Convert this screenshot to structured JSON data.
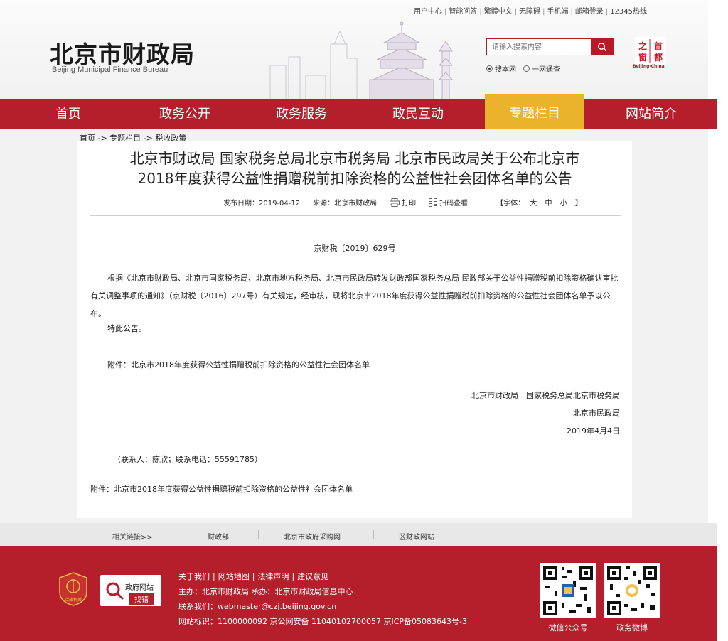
{
  "header": {
    "util_links": [
      "用户中心",
      "智能问答",
      "繁體中文",
      "无障碍",
      "手机端",
      "邮箱登录",
      "12345热线"
    ],
    "logo_cn": "北京市财政局",
    "logo_en": "Beijing Municipal Finance Bureau",
    "search": {
      "placeholder": "请输入搜索内容"
    },
    "radio_site": "搜本网",
    "radio_all": "一网通查",
    "seal_text": [
      "首",
      "都",
      "之",
      "窗"
    ],
    "seal_caption": "Beijing·China"
  },
  "nav": {
    "items": [
      "首页",
      "政务公开",
      "政务服务",
      "政民互动",
      "专题栏目",
      "网站简介"
    ],
    "active_index": 4
  },
  "breadcrumb": "首页 -> 专题栏目 -> 税收政策",
  "article": {
    "title_line1": "北京市财政局 国家税务总局北京市税务局 北京市民政局关于公布北京市",
    "title_line2": "2018年度获得公益性捐赠税前扣除资格的公益性社会团体名单的公告",
    "publish_date": "发布日期：2019-04-12",
    "source": "来源：北京市财政局",
    "print_label": "打印",
    "qr_label": "扫码查看",
    "font_label": "【字体：",
    "font_large": "大",
    "font_medium": "中",
    "font_small": "小",
    "font_end": "】",
    "doc_number": "京财税〔2019〕629号",
    "paragraph1": "根据《北京市财政局、北京市国家税务局、北京市地方税务局、北京市民政局转发财政部国家税务总局 民政部关于公益性捐赠税前扣除资格确认审批有关调整事项的通知》（京财税〔2016〕297号）有关规定，经审核，现将北京市2018年度获得公益性捐赠税前扣除资格的公益性社会团体名单予以公布。",
    "paragraph2": "特此公告。",
    "paragraph3": "附件：北京市2018年度获得公益性捐赠税前扣除资格的公益性社会团体名单",
    "sign1": "北京市财政局　国家税务总局北京市税务局",
    "sign2": "北京市民政局",
    "sign_date": "2019年4月4日",
    "contact": "（联系人：陈欣；联系电话：55591785）",
    "attachment": "附件：北京市2018年度获得公益性捐赠税前扣除资格的公益性社会团体名单"
  },
  "related_links": {
    "label": "相关链接>>",
    "items": [
      "财政部",
      "北京市政府采购网",
      "区财政网站"
    ]
  },
  "footer": {
    "badge_text": "党政机关",
    "jc_title": "政府网站",
    "jc_action": "找错",
    "links": [
      "关于我们",
      "网站地图",
      "法律声明",
      "建议意见"
    ],
    "line2": "主办：北京市财政局  承办：北京市财政局信息中心",
    "line3": "联系我们：webmaster@czj.beijing.gov.cn",
    "line4": "网站标识：1100000092  京公网安备 11040102700057  京ICP备05083643号-3",
    "qr1_caption": "微信公众号",
    "qr2_caption": "政务微博"
  },
  "colors": {
    "brand_red": "#b51f2b",
    "active_gold": "#e9b32c"
  }
}
